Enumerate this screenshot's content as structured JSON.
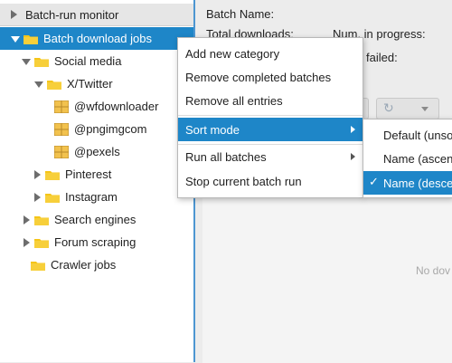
{
  "tree": {
    "header": "Batch-run monitor",
    "items": [
      {
        "label": "Batch download jobs",
        "type": "folder",
        "state": "expanded",
        "selected": true
      },
      {
        "label": "Social media",
        "type": "folder",
        "state": "expanded"
      },
      {
        "label": "X/Twitter",
        "type": "folder",
        "state": "expanded"
      },
      {
        "label": "@wfdownloader",
        "type": "batch"
      },
      {
        "label": "@pngimgcom",
        "type": "batch"
      },
      {
        "label": "@pexels",
        "type": "batch"
      },
      {
        "label": "Pinterest",
        "type": "folder",
        "state": "collapsed"
      },
      {
        "label": "Instagram",
        "type": "folder",
        "state": "collapsed"
      },
      {
        "label": "Search engines",
        "type": "folder",
        "state": "collapsed"
      },
      {
        "label": "Forum scraping",
        "type": "folder",
        "state": "collapsed"
      },
      {
        "label": "Crawler jobs",
        "type": "folder",
        "state": "none"
      }
    ]
  },
  "details": {
    "batch_name_label": "Batch Name:",
    "total_downloads_label": "Total downloads:",
    "num_in_progress_label": "Num. in progress:",
    "failed_label": "failed:",
    "empty_text": "No dov"
  },
  "context_menu": {
    "items": [
      {
        "label": "Add new category"
      },
      {
        "label": "Remove completed batches"
      },
      {
        "label": "Remove all entries"
      },
      {
        "label": "Sort mode",
        "submenu": true,
        "active": true
      },
      {
        "label": "Run all batches",
        "submenu": true
      },
      {
        "label": "Stop current batch run"
      }
    ]
  },
  "submenu": {
    "items": [
      {
        "label": "Default (unso"
      },
      {
        "label": "Name (ascen"
      },
      {
        "label": "Name (desce",
        "checked": true,
        "active": true
      }
    ],
    "check_glyph": "✓"
  },
  "colors": {
    "selection": "#1e86c8",
    "folder": "#f5c518",
    "divider": "#4d96d1"
  },
  "icons": {
    "refresh": "↻"
  }
}
